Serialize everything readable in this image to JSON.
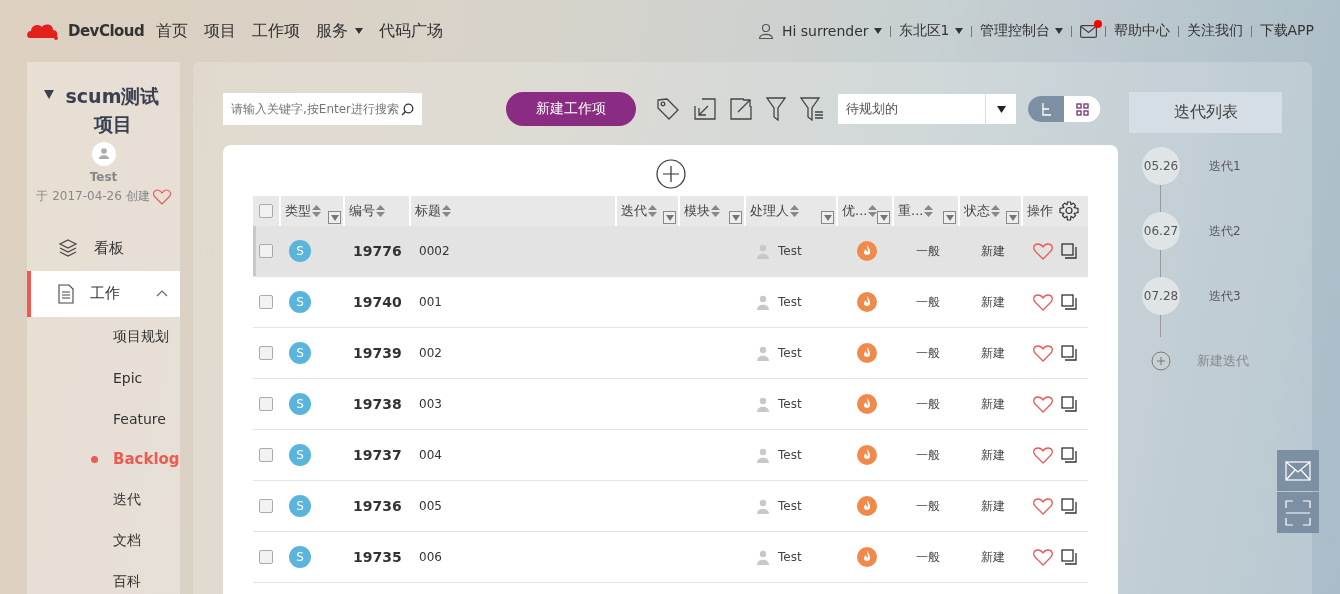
{
  "header": {
    "logo_text": "DevCloud",
    "nav": [
      {
        "label": "首页",
        "dropdown": false
      },
      {
        "label": "项目",
        "dropdown": false
      },
      {
        "label": "工作项",
        "dropdown": false
      },
      {
        "label": "服务",
        "dropdown": true
      },
      {
        "label": "代码广场",
        "dropdown": false
      }
    ],
    "user": "Hi surrender",
    "region": "东北区1",
    "console": "管理控制台",
    "mail_unread": true,
    "links": [
      "帮助中心",
      "关注我们",
      "下载APP"
    ]
  },
  "sidebar": {
    "project_title": "scum测试项目",
    "owner": "Test",
    "created": "于 2017-04-26 创建",
    "menu": [
      {
        "label": "看板",
        "selected": false
      },
      {
        "label": "工作",
        "selected": true,
        "expanded": true,
        "children": [
          {
            "label": "项目规划",
            "selected": false
          },
          {
            "label": "Epic",
            "selected": false
          },
          {
            "label": "Feature",
            "selected": false
          },
          {
            "label": "Backlog",
            "selected": true
          },
          {
            "label": "迭代",
            "selected": false
          },
          {
            "label": "文档",
            "selected": false
          },
          {
            "label": "百科",
            "selected": false
          }
        ]
      }
    ]
  },
  "toolbar": {
    "search_placeholder": "请输入关键字,按Enter进行搜索",
    "new_button": "新建工作项",
    "filter_value": "待规划的",
    "views": [
      {
        "kind": "tree",
        "selected": true
      },
      {
        "kind": "grid",
        "selected": false
      }
    ],
    "iteration_list_button": "迭代列表"
  },
  "table": {
    "select_all_checked": false,
    "columns": [
      {
        "label": "类型",
        "sortable": true,
        "filterable": true,
        "settings": false
      },
      {
        "label": "编号",
        "sortable": true,
        "filterable": false,
        "settings": false
      },
      {
        "label": "标题",
        "sortable": true,
        "filterable": false,
        "settings": false
      },
      {
        "label": "迭代",
        "sortable": true,
        "filterable": true,
        "settings": false
      },
      {
        "label": "模块",
        "sortable": true,
        "filterable": true,
        "settings": false
      },
      {
        "label": "处理人",
        "sortable": true,
        "filterable": true,
        "settings": false
      },
      {
        "label": "优...",
        "sortable": true,
        "filterable": true,
        "settings": false
      },
      {
        "label": "重...",
        "sortable": true,
        "filterable": true,
        "settings": false
      },
      {
        "label": "状态",
        "sortable": true,
        "filterable": true,
        "settings": false
      },
      {
        "label": "操作",
        "sortable": false,
        "filterable": false,
        "settings": true
      }
    ],
    "rows": [
      {
        "checked": false,
        "highlighted": true,
        "type": "S",
        "id": "19776",
        "title": "0002",
        "assignee": "Test",
        "importance": "一般",
        "status": "新建"
      },
      {
        "checked": false,
        "highlighted": false,
        "type": "S",
        "id": "19740",
        "title": "001",
        "assignee": "Test",
        "importance": "一般",
        "status": "新建"
      },
      {
        "checked": false,
        "highlighted": false,
        "type": "S",
        "id": "19739",
        "title": "002",
        "assignee": "Test",
        "importance": "一般",
        "status": "新建"
      },
      {
        "checked": false,
        "highlighted": false,
        "type": "S",
        "id": "19738",
        "title": "003",
        "assignee": "Test",
        "importance": "一般",
        "status": "新建"
      },
      {
        "checked": false,
        "highlighted": false,
        "type": "S",
        "id": "19737",
        "title": "004",
        "assignee": "Test",
        "importance": "一般",
        "status": "新建"
      },
      {
        "checked": false,
        "highlighted": false,
        "type": "S",
        "id": "19736",
        "title": "005",
        "assignee": "Test",
        "importance": "一般",
        "status": "新建"
      },
      {
        "checked": false,
        "highlighted": false,
        "type": "S",
        "id": "19735",
        "title": "006",
        "assignee": "Test",
        "importance": "一般",
        "status": "新建"
      }
    ]
  },
  "iterations": [
    {
      "date": "05.26",
      "name": "迭代1"
    },
    {
      "date": "06.27",
      "name": "迭代2"
    },
    {
      "date": "07.28",
      "name": "迭代3"
    }
  ],
  "new_iteration": "新建迭代"
}
